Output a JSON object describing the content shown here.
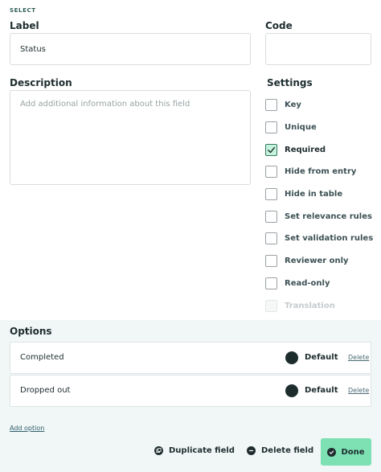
{
  "field_type": "SELECT",
  "label": {
    "title": "Label",
    "value": "Status"
  },
  "code": {
    "title": "Code",
    "value": ""
  },
  "description": {
    "title": "Description",
    "placeholder": "Add additional information about this field",
    "value": ""
  },
  "settings": {
    "title": "Settings",
    "items": [
      {
        "label": "Key",
        "checked": false,
        "disabled": false
      },
      {
        "label": "Unique",
        "checked": false,
        "disabled": false
      },
      {
        "label": "Required",
        "checked": true,
        "disabled": false
      },
      {
        "label": "Hide from entry",
        "checked": false,
        "disabled": false
      },
      {
        "label": "Hide in table",
        "checked": false,
        "disabled": false
      },
      {
        "label": "Set relevance rules",
        "checked": false,
        "disabled": false
      },
      {
        "label": "Set validation rules",
        "checked": false,
        "disabled": false
      },
      {
        "label": "Reviewer only",
        "checked": false,
        "disabled": false
      },
      {
        "label": "Read-only",
        "checked": false,
        "disabled": false
      },
      {
        "label": "Translation",
        "checked": false,
        "disabled": true
      }
    ]
  },
  "options": {
    "title": "Options",
    "items": [
      {
        "name": "Completed",
        "color_label": "Default",
        "color": "#1d2c2d",
        "delete_label": "Delete"
      },
      {
        "name": "Dropped out",
        "color_label": "Default",
        "color": "#1d2c2d",
        "delete_label": "Delete"
      }
    ],
    "add_label": "Add option"
  },
  "actions": {
    "duplicate_label": "Duplicate field",
    "delete_label": "Delete field",
    "done_label": "Done"
  },
  "colors": {
    "accent": "#7de1b4",
    "check_fill": "#c7f2dd",
    "panel_bg": "#f1f6f6"
  }
}
